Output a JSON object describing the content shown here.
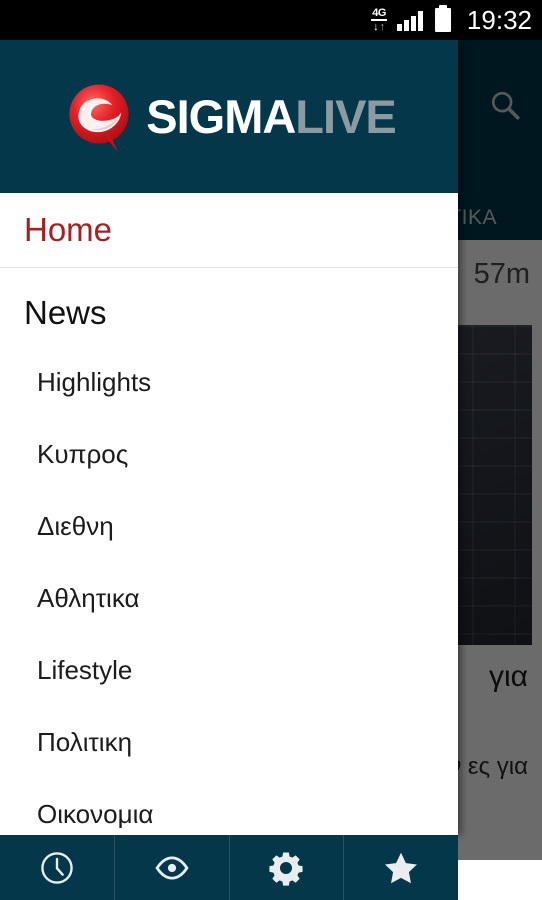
{
  "statusbar": {
    "network_label": "4G",
    "arrow_down": "↓",
    "arrow_up": "↑",
    "time": "19:32"
  },
  "background": {
    "tab_label": "ΙΤΙΚΑ",
    "search_icon": "search-icon",
    "article_time": "57m",
    "article_title": "για",
    "article_body": "σεων\nες\nγια"
  },
  "drawer": {
    "brand": {
      "logo_icon": "sigma-speech-bubble-logo",
      "name_primary": "SIGMA",
      "name_secondary": "LIVE"
    },
    "home_label": "Home",
    "section_title": "News",
    "items": [
      {
        "label": "Highlights"
      },
      {
        "label": "Κυπρος"
      },
      {
        "label": "Διεθνη"
      },
      {
        "label": "Αθλητικα"
      },
      {
        "label": "Lifestyle"
      },
      {
        "label": "Πολιτικη"
      },
      {
        "label": "Οικονομια"
      }
    ]
  },
  "bottombar": {
    "buttons": [
      {
        "icon": "clock-icon",
        "name": "recent"
      },
      {
        "icon": "eye-icon",
        "name": "most-viewed"
      },
      {
        "icon": "gear-icon",
        "name": "settings"
      },
      {
        "icon": "star-icon",
        "name": "favorites"
      }
    ]
  },
  "colors": {
    "header_teal": "#04374a",
    "accent_red": "#a81f1f",
    "logo_red": "#d81f26",
    "logo_live_gray": "#8b9ba3",
    "scrim": "rgba(0,0,0,0.58)"
  }
}
